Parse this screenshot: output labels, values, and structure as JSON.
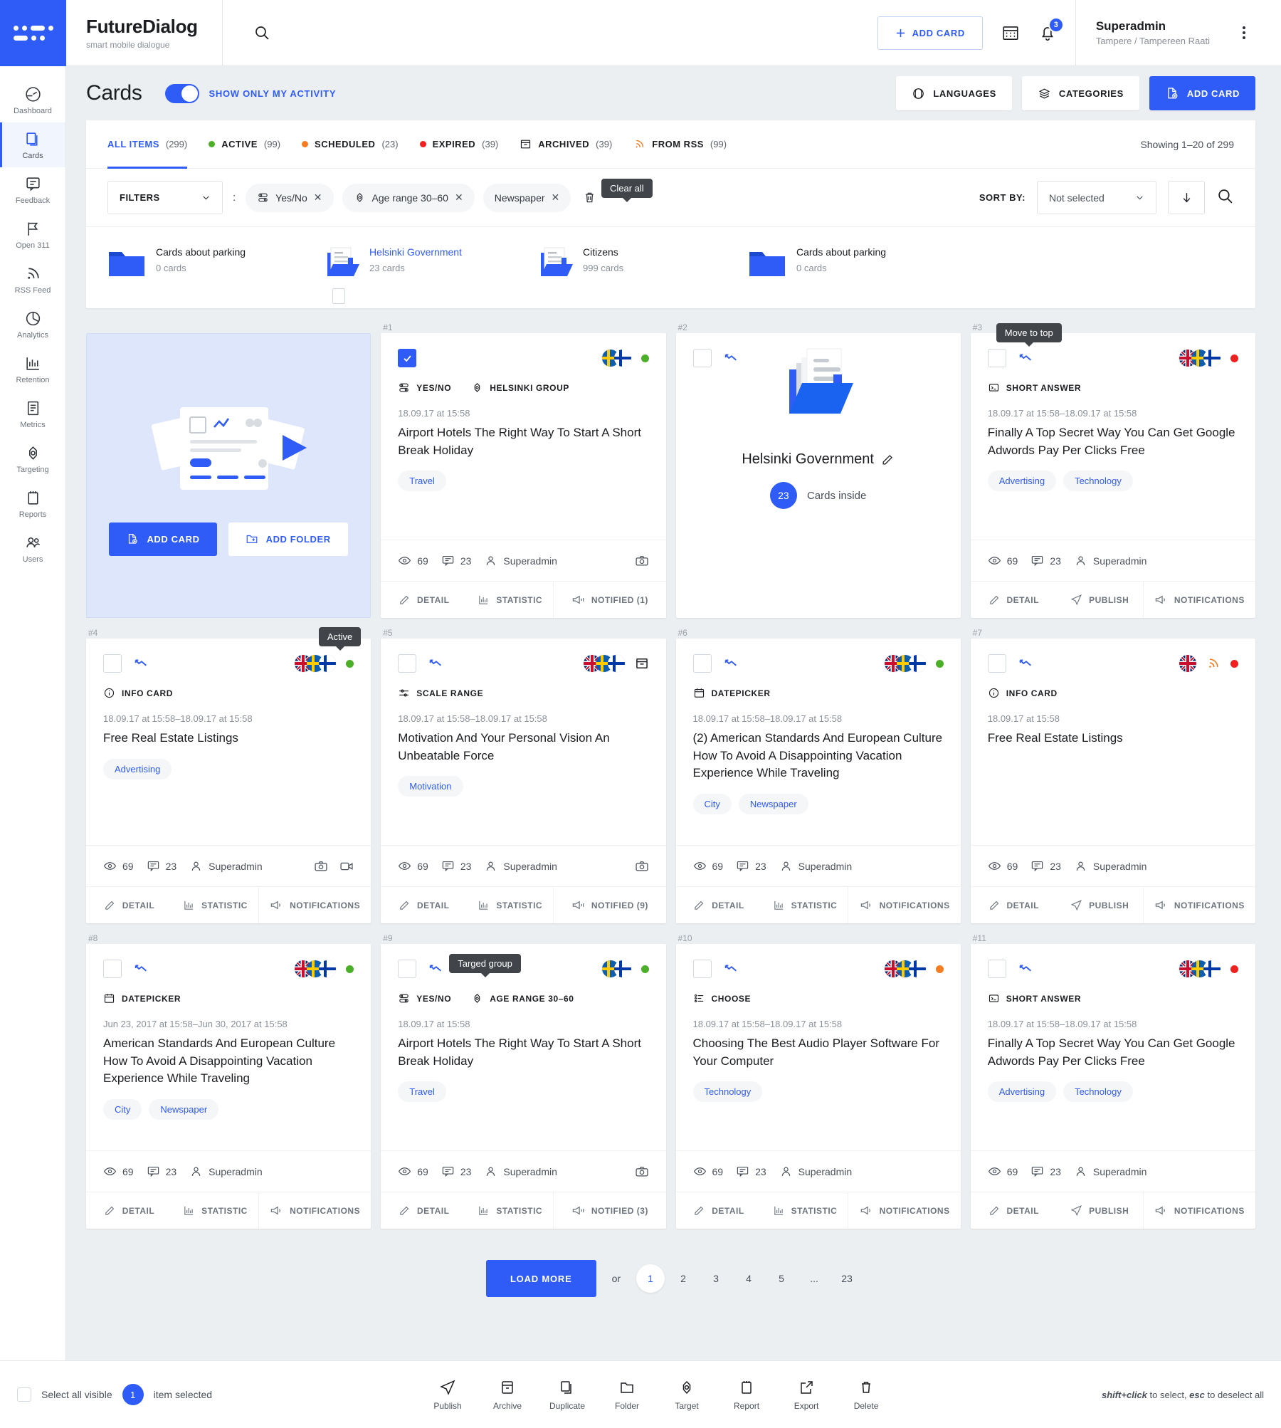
{
  "brand": {
    "name": "FutureDialog",
    "tagline": "smart mobile dialogue"
  },
  "topbar": {
    "add_card_label": "ADD CARD",
    "notifications_count": "3",
    "user_name": "Superadmin",
    "user_org": "Tampere / Tampereen Raati",
    "search_icon": "search-icon",
    "calendar_icon": "calendar-icon",
    "bell_icon": "bell-icon",
    "kebab_icon": "kebab-menu-icon"
  },
  "sidebar": {
    "items": [
      {
        "label": "Dashboard",
        "icon": "dashboard-icon",
        "active": false
      },
      {
        "label": "Cards",
        "icon": "cards-icon",
        "active": true
      },
      {
        "label": "Feedback",
        "icon": "feedback-icon",
        "active": false
      },
      {
        "label": "Open 311",
        "icon": "flag-icon",
        "active": false
      },
      {
        "label": "RSS Feed",
        "icon": "rss-icon",
        "active": false
      },
      {
        "label": "Analytics",
        "icon": "pie-chart-icon",
        "active": false
      },
      {
        "label": "Retention",
        "icon": "bar-chart-icon",
        "active": false
      },
      {
        "label": "Metrics",
        "icon": "document-icon",
        "active": false
      },
      {
        "label": "Targeting",
        "icon": "target-icon",
        "active": false
      },
      {
        "label": "Reports",
        "icon": "notepad-icon",
        "active": false
      },
      {
        "label": "Users",
        "icon": "users-icon",
        "active": false
      }
    ]
  },
  "page": {
    "title": "Cards",
    "toggle_label": "SHOW ONLY MY ACTIVITY",
    "toggle_on": true,
    "buttons": [
      {
        "label": "LANGUAGES",
        "icon": "globe-icon",
        "primary": false
      },
      {
        "label": "CATEGORIES",
        "icon": "layers-icon",
        "primary": false
      },
      {
        "label": "ADD CARD",
        "icon": "add-card-icon",
        "primary": true
      }
    ]
  },
  "tabs": [
    {
      "label": "ALL ITEMS",
      "count": "(299)",
      "dot": "",
      "icon": "",
      "active": true
    },
    {
      "label": "ACTIVE",
      "count": "(99)",
      "dot": "#4caf28",
      "icon": "",
      "active": false
    },
    {
      "label": "SCHEDULED",
      "count": "(23)",
      "dot": "#f57c20",
      "icon": "",
      "active": false
    },
    {
      "label": "EXPIRED",
      "count": "(39)",
      "dot": "#ee2020",
      "icon": "",
      "active": false
    },
    {
      "label": "ARCHIVED",
      "count": "(39)",
      "dot": "",
      "icon": "archive-icon",
      "active": false
    },
    {
      "label": "FROM RSS",
      "count": "(99)",
      "dot": "",
      "icon": "rss-icon",
      "active": false
    }
  ],
  "showing_text": "Showing 1–20 of 299",
  "filters": {
    "select_label": "FILTERS",
    "separator": ":",
    "chips": [
      {
        "label": "Yes/No",
        "icon": "yesno-icon"
      },
      {
        "label": "Age range 30–60",
        "icon": "target-icon"
      },
      {
        "label": "Newspaper",
        "icon": ""
      }
    ],
    "clear_all_tooltip": "Clear all",
    "trash_icon": "trash-icon",
    "sort_label": "SORT BY:",
    "sort_value": "Not selected",
    "sort_dir_icon": "arrow-down-icon",
    "search_icon": "search-icon"
  },
  "folders": [
    {
      "name": "Cards about parking",
      "count": "0 cards",
      "link": false,
      "filled": false,
      "checkbox": false
    },
    {
      "name": "Helsinki Government",
      "count": "23 cards",
      "link": true,
      "filled": true,
      "checkbox": true
    },
    {
      "name": "Citizens",
      "count": "999 cards",
      "link": false,
      "filled": true,
      "checkbox": false
    },
    {
      "name": "Cards about parking",
      "count": "0 cards",
      "link": false,
      "filled": false,
      "checkbox": false
    }
  ],
  "promo_card": {
    "add_card_label": "ADD CARD",
    "add_folder_label": "ADD FOLDER",
    "add_card_icon": "add-card-icon",
    "add_folder_icon": "add-folder-icon"
  },
  "cards": [
    {
      "num": "#1",
      "kind": "card",
      "checked": true,
      "tooltip": "",
      "flags": [
        "se",
        "fi"
      ],
      "status": "#4caf28",
      "types": [
        {
          "label": "YES/NO",
          "icon": "yesno-icon"
        },
        {
          "label": "HELSINKI GROUP",
          "icon": "target-icon"
        }
      ],
      "date": "18.09.17 at 15:58",
      "title": "Airport Hotels The Right Way To Start A Short Break Holiday",
      "tags": [
        "Travel"
      ],
      "views": "69",
      "comments": "23",
      "author": "Superadmin",
      "media": [
        "camera-icon"
      ],
      "actions": [
        {
          "label": "DETAIL",
          "icon": "edit-icon"
        },
        {
          "label": "STATISTIC",
          "icon": "bar-chart-icon"
        },
        {
          "label": "NOTIFIED (1)",
          "icon": "megaphone-sent-icon"
        }
      ]
    },
    {
      "num": "#2",
      "kind": "folder",
      "checked": false,
      "tooltip": "",
      "folder_title": "Helsinki Government",
      "folder_count": "23",
      "folder_count_label": "Cards inside",
      "edit_icon": "pencil-icon"
    },
    {
      "num": "#3",
      "kind": "card",
      "checked": false,
      "tooltip": "Move to top",
      "flags": [
        "gb",
        "se",
        "fi"
      ],
      "status": "#ee2020",
      "types": [
        {
          "label": "SHORT ANSWER",
          "icon": "short-answer-icon"
        }
      ],
      "date": "18.09.17 at 15:58–18.09.17 at 15:58",
      "title": "Finally A Top Secret Way You Can Get Google Adwords Pay Per Clicks Free",
      "tags": [
        "Advertising",
        "Technology"
      ],
      "views": "69",
      "comments": "23",
      "author": "Superadmin",
      "media": [],
      "actions": [
        {
          "label": "DETAIL",
          "icon": "edit-icon"
        },
        {
          "label": "PUBLISH",
          "icon": "send-icon"
        },
        {
          "label": "NOTIFICATIONS",
          "icon": "megaphone-icon"
        }
      ]
    },
    {
      "num": "#4",
      "kind": "card",
      "checked": false,
      "tooltip": "Active",
      "flags": [
        "gb",
        "se",
        "fi"
      ],
      "status": "#4caf28",
      "types": [
        {
          "label": "INFO CARD",
          "icon": "info-icon"
        }
      ],
      "date": "18.09.17 at 15:58–18.09.17 at 15:58",
      "title": "Free Real Estate Listings",
      "tags": [
        "Advertising"
      ],
      "views": "69",
      "comments": "23",
      "author": "Superadmin",
      "media": [
        "camera-icon",
        "video-icon"
      ],
      "actions": [
        {
          "label": "DETAIL",
          "icon": "edit-icon"
        },
        {
          "label": "STATISTIC",
          "icon": "bar-chart-icon"
        },
        {
          "label": "NOTIFICATIONS",
          "icon": "megaphone-icon"
        }
      ]
    },
    {
      "num": "#5",
      "kind": "card",
      "checked": false,
      "tooltip": "",
      "flags": [
        "gb",
        "se",
        "fi"
      ],
      "status": "",
      "status_icon": "archive-icon",
      "types": [
        {
          "label": "SCALE RANGE",
          "icon": "scale-range-icon"
        }
      ],
      "date": "18.09.17 at 15:58–18.09.17 at 15:58",
      "title": "Motivation And Your Personal Vision An Unbeatable Force",
      "tags": [
        "Motivation"
      ],
      "views": "69",
      "comments": "23",
      "author": "Superadmin",
      "media": [
        "camera-icon"
      ],
      "actions": [
        {
          "label": "DETAIL",
          "icon": "edit-icon"
        },
        {
          "label": "STATISTIC",
          "icon": "bar-chart-icon"
        },
        {
          "label": "NOTIFIED (9)",
          "icon": "megaphone-sent-icon"
        }
      ]
    },
    {
      "num": "#6",
      "kind": "card",
      "checked": false,
      "tooltip": "",
      "flags": [
        "gb",
        "se",
        "fi"
      ],
      "status": "#4caf28",
      "types": [
        {
          "label": "DATEPICKER",
          "icon": "calendar-icon"
        }
      ],
      "date": "18.09.17 at 15:58–18.09.17 at 15:58",
      "title": "(2) American Standards And European Culture How To Avoid A Disappointing Vacation Experience While Traveling",
      "tags": [
        "City",
        "Newspaper"
      ],
      "views": "69",
      "comments": "23",
      "author": "Superadmin",
      "media": [],
      "actions": [
        {
          "label": "DETAIL",
          "icon": "edit-icon"
        },
        {
          "label": "STATISTIC",
          "icon": "bar-chart-icon"
        },
        {
          "label": "NOTIFICATIONS",
          "icon": "megaphone-icon"
        }
      ]
    },
    {
      "num": "#7",
      "kind": "card",
      "checked": false,
      "tooltip": "",
      "flags": [
        "gb"
      ],
      "extra_icon": "rss-icon",
      "status": "#ee2020",
      "types": [
        {
          "label": "INFO CARD",
          "icon": "info-icon"
        }
      ],
      "date": "18.09.17 at 15:58",
      "title": "Free Real Estate Listings",
      "tags": [],
      "views": "69",
      "comments": "23",
      "author": "Superadmin",
      "media": [],
      "actions": [
        {
          "label": "DETAIL",
          "icon": "edit-icon"
        },
        {
          "label": "PUBLISH",
          "icon": "send-icon"
        },
        {
          "label": "NOTIFICATIONS",
          "icon": "megaphone-icon"
        }
      ]
    },
    {
      "num": "#8",
      "kind": "card",
      "checked": false,
      "tooltip": "",
      "flags": [
        "gb",
        "se",
        "fi"
      ],
      "status": "#4caf28",
      "types": [
        {
          "label": "DATEPICKER",
          "icon": "calendar-icon"
        }
      ],
      "date": "Jun 23, 2017 at 15:58–Jun 30, 2017 at 15:58",
      "title": "American Standards And European Culture How To Avoid A Disappointing Vacation Experience While Traveling",
      "tags": [
        "City",
        "Newspaper"
      ],
      "views": "69",
      "comments": "23",
      "author": "Superadmin",
      "media": [],
      "actions": [
        {
          "label": "DETAIL",
          "icon": "edit-icon"
        },
        {
          "label": "STATISTIC",
          "icon": "bar-chart-icon"
        },
        {
          "label": "NOTIFICATIONS",
          "icon": "megaphone-icon"
        }
      ]
    },
    {
      "num": "#9",
      "kind": "card",
      "checked": false,
      "tooltip": "Targed group",
      "flags": [
        "se",
        "fi"
      ],
      "status": "#4caf28",
      "types": [
        {
          "label": "YES/NO",
          "icon": "yesno-icon"
        },
        {
          "label": "AGE RANGE 30–60",
          "icon": "target-icon"
        }
      ],
      "date": "18.09.17 at 15:58",
      "title": "Airport Hotels The Right Way To Start A Short Break Holiday",
      "tags": [
        "Travel"
      ],
      "views": "69",
      "comments": "23",
      "author": "Superadmin",
      "media": [
        "camera-icon"
      ],
      "actions": [
        {
          "label": "DETAIL",
          "icon": "edit-icon"
        },
        {
          "label": "STATISTIC",
          "icon": "bar-chart-icon"
        },
        {
          "label": "NOTIFIED (3)",
          "icon": "megaphone-sent-icon"
        }
      ]
    },
    {
      "num": "#10",
      "kind": "card",
      "checked": false,
      "tooltip": "",
      "flags": [
        "gb",
        "se",
        "fi"
      ],
      "status": "#f57c20",
      "types": [
        {
          "label": "CHOOSE",
          "icon": "choose-icon"
        }
      ],
      "date": "18.09.17 at 15:58–18.09.17 at 15:58",
      "title": "Choosing The Best Audio Player Software For Your Computer",
      "tags": [
        "Technology"
      ],
      "views": "69",
      "comments": "23",
      "author": "Superadmin",
      "media": [],
      "actions": [
        {
          "label": "DETAIL",
          "icon": "edit-icon"
        },
        {
          "label": "STATISTIC",
          "icon": "bar-chart-icon"
        },
        {
          "label": "NOTIFICATIONS",
          "icon": "megaphone-icon"
        }
      ]
    },
    {
      "num": "#11",
      "kind": "card",
      "checked": false,
      "tooltip": "",
      "flags": [
        "gb",
        "se",
        "fi"
      ],
      "status": "#ee2020",
      "types": [
        {
          "label": "SHORT ANSWER",
          "icon": "short-answer-icon"
        }
      ],
      "date": "18.09.17 at 15:58–18.09.17 at 15:58",
      "title": "Finally A Top Secret Way You Can Get Google Adwords Pay Per Clicks Free",
      "tags": [
        "Advertising",
        "Technology"
      ],
      "views": "69",
      "comments": "23",
      "author": "Superadmin",
      "media": [],
      "actions": [
        {
          "label": "DETAIL",
          "icon": "edit-icon"
        },
        {
          "label": "PUBLISH",
          "icon": "send-icon"
        },
        {
          "label": "NOTIFICATIONS",
          "icon": "megaphone-icon"
        }
      ]
    }
  ],
  "pagination": {
    "load_more_label": "LOAD MORE",
    "or_label": "or",
    "pages": [
      "1",
      "2",
      "3",
      "4",
      "5",
      "...",
      "23"
    ],
    "current": "1"
  },
  "bottombar": {
    "select_all_label": "Select all visible",
    "selected_count": "1",
    "selected_label": "item selected",
    "tools": [
      {
        "label": "Publish",
        "icon": "send-icon"
      },
      {
        "label": "Archive",
        "icon": "archive-icon"
      },
      {
        "label": "Duplicate",
        "icon": "duplicate-icon"
      },
      {
        "label": "Folder",
        "icon": "folder-icon"
      },
      {
        "label": "Target",
        "icon": "target-icon"
      },
      {
        "label": "Report",
        "icon": "notepad-icon"
      },
      {
        "label": "Export",
        "icon": "export-icon"
      },
      {
        "label": "Delete",
        "icon": "trash-icon"
      }
    ],
    "hint_prefix": "shift+click",
    "hint_mid": " to select, ",
    "hint_key": "esc",
    "hint_suffix": " to deselect all"
  },
  "colors": {
    "accent": "#2f5bf6",
    "active": "#4caf28",
    "scheduled": "#f57c20",
    "expired": "#ee2020",
    "bg": "#eceff1"
  }
}
